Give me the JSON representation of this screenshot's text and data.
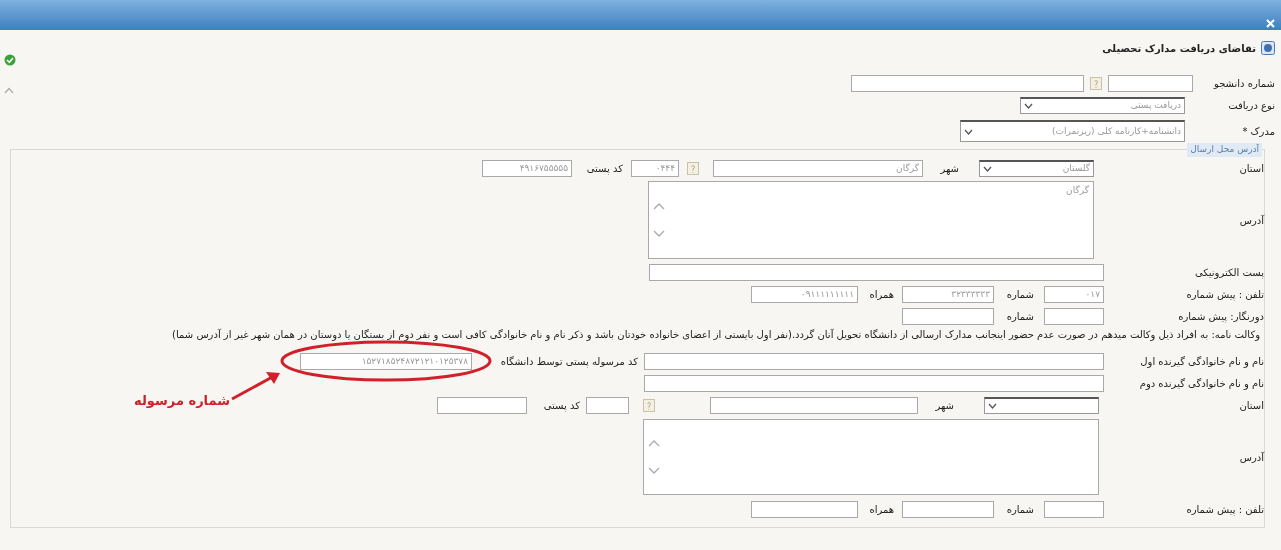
{
  "form": {
    "title": "تقاضای دریافت مدارک تحصیلی",
    "student_number": {
      "label": "شماره دانشجو"
    },
    "receive_type": {
      "label": "نوع دریافت",
      "value": "دریافت پستی"
    },
    "document": {
      "label": "مدرک *",
      "value": "دانشنامه+کارنامه کلی (ریزنمرات)"
    }
  },
  "send_address": {
    "legend": "آدرس محل ارسال",
    "province": {
      "label": "استان",
      "value": "گلستان"
    },
    "city": {
      "label": "شهر",
      "value": "گرگان"
    },
    "city_code": {
      "value": "۰۴۴۴"
    },
    "postal_code": {
      "label": "کد پستی",
      "value": "۴۹۱۶۷۵۵۵۵۵"
    },
    "address": {
      "label": "آدرس",
      "value": "گرگان"
    },
    "email": {
      "label": "پست الکترونیکی"
    },
    "phone": {
      "label": "تلفن : پیش شماره",
      "prefix": "۰۱۷",
      "number_label": "شماره",
      "number": "۳۲۳۳۳۳۳۳",
      "mobile_label": "همراه",
      "mobile": "۰۹۱۱۱۱۱۱۱۱۱"
    },
    "fax": {
      "label": "دورنگار: پیش شماره",
      "number_label": "شماره"
    },
    "proxy_note": "وکالت نامه: به افراد ذیل وکالت میدهم در صورت عدم حضور اینجانب مدارک ارسالی از دانشگاه تحویل آنان گردد.(نفر اول بایستی از اعضای خانواده خودتان باشد و ذکر نام و نام خانوادگی کافی است و نفر دوم از بستگان یا دوستان در همان شهر غیر از آدرس شما)",
    "first_recipient": {
      "label": "نام و نام خانوادگی گیرنده اول",
      "tracking_label": "کد مرسوله پستی توسط دانشگاه",
      "tracking_code": "۱۵۲۷۱۸۵۲۴۸۷۲۱۲۱۰۱۲۵۳۷۸"
    },
    "second_recipient": {
      "label": "نام و نام خانوادگی گیرنده دوم"
    },
    "second_address": {
      "province_label": "استان",
      "city_label": "شهر",
      "postal_label": "کد پستی",
      "address_label": "آدرس",
      "phone_label": "تلفن : پیش شماره",
      "number_label": "شماره",
      "mobile_label": "همراه"
    }
  },
  "annotation": {
    "text": "شماره مرسوله"
  }
}
